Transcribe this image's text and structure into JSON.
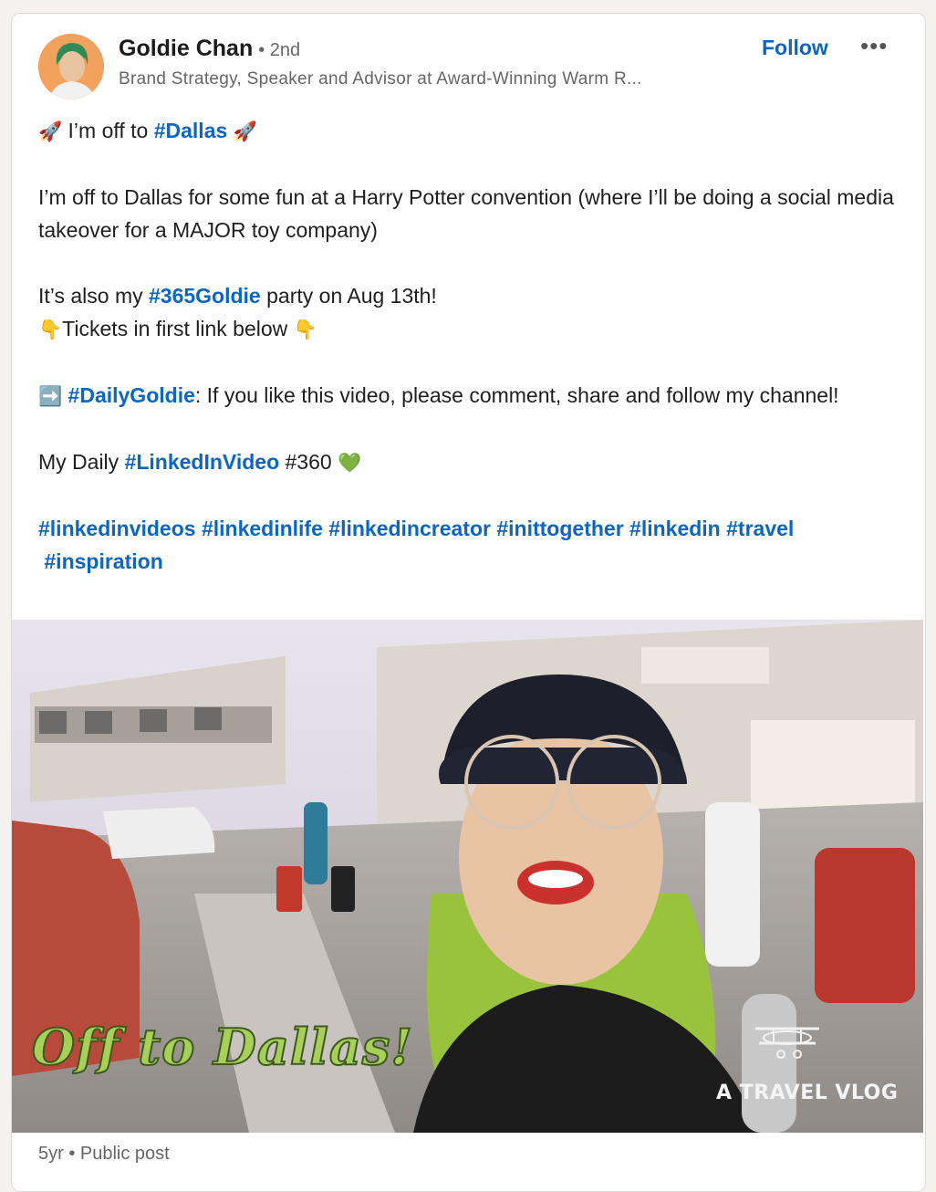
{
  "author": {
    "name": "Goldie Chan",
    "degree": "• 2nd",
    "headline": "Brand Strategy, Speaker and Advisor at Award-Winning Warm R...",
    "avatar_icon": "profile-photo"
  },
  "actions": {
    "follow_label": "Follow",
    "more_label": "•••"
  },
  "post": {
    "line1": {
      "emoji_left": "🚀",
      "text": " I’m off to ",
      "tag": "#Dallas",
      "emoji_right": "🚀"
    },
    "para2": "I’m off to Dallas for some fun at a Harry Potter convention (where I’ll be doing a social media takeover for a MAJOR toy company)",
    "para3": {
      "prefix": "It’s also my ",
      "tag": "#365Goldie",
      "suffix": " party on Aug 13th!",
      "emoji_left": "👇",
      "line2": "Tickets in first link below ",
      "emoji_right": "👇"
    },
    "para4": {
      "emoji": "➡️",
      "tag": "#DailyGoldie",
      "text": ": If you like this video, please comment, share and follow my channel!"
    },
    "para5": {
      "prefix": "My Daily ",
      "tag": "#LinkedInVideo",
      "suffix": " #360 ",
      "emoji": "💚"
    },
    "hashtags": [
      "#linkedinvideos",
      "#linkedinlife",
      "#linkedincreator",
      "#inittogether",
      "#linkedin",
      "#travel",
      "#inspiration"
    ]
  },
  "video": {
    "overlay_title": "Off to Dallas!",
    "overlay_brand": "A TRAVEL VLOG",
    "plane_icon": "biplane-icon"
  },
  "footer": {
    "meta": "5yr • Public post"
  },
  "colors": {
    "link": "#0a66c2",
    "text": "#1f1f1f",
    "muted": "#666666",
    "background": "#f4f2ee",
    "card": "#ffffff"
  }
}
